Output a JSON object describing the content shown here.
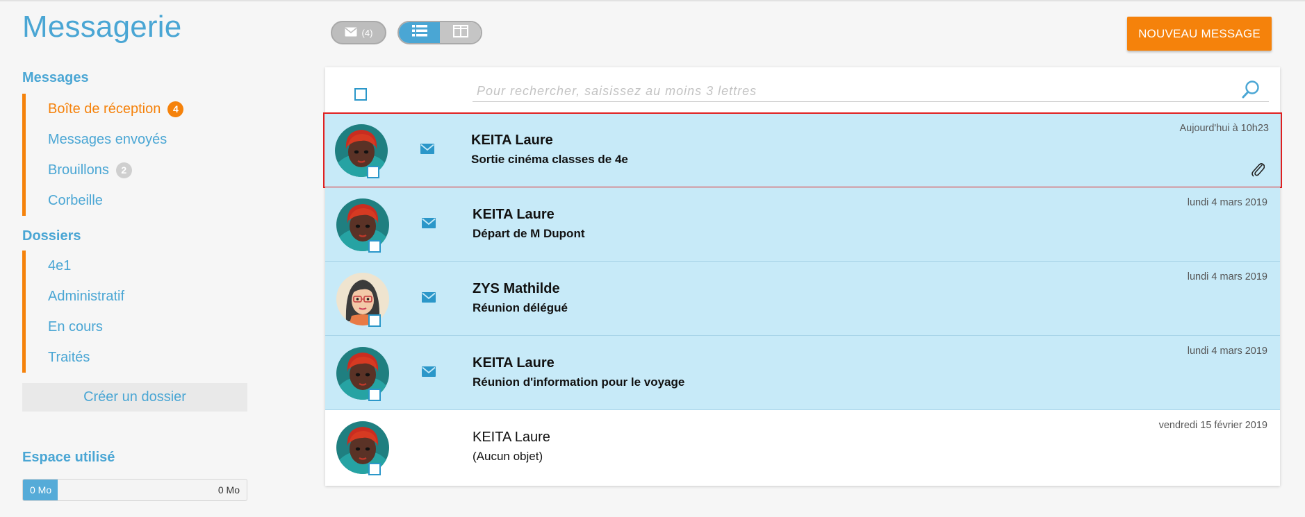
{
  "app": {
    "title": "Messagerie"
  },
  "sidebar": {
    "messages_title": "Messages",
    "message_items": [
      {
        "label": "Boîte de réception",
        "badge": "4",
        "badge_color": "#f5820b",
        "active": true
      },
      {
        "label": "Messages envoyés"
      },
      {
        "label": "Brouillons",
        "badge": "2",
        "badge_color": "#cfcfcf"
      },
      {
        "label": "Corbeille"
      }
    ],
    "folders_title": "Dossiers",
    "folder_items": [
      {
        "label": "4e1"
      },
      {
        "label": "Administratif"
      },
      {
        "label": "En cours"
      },
      {
        "label": "Traités"
      }
    ],
    "create_folder_label": "Créer un dossier",
    "storage_title": "Espace utilisé",
    "storage_used": "0 Mo",
    "storage_max": "0 Mo"
  },
  "toolbar": {
    "mail_count": "(4)",
    "new_message_label": "NOUVEAU MESSAGE",
    "view_modes": [
      {
        "icon": "list-icon",
        "active": true
      },
      {
        "icon": "split-view-icon",
        "active": false
      }
    ]
  },
  "search": {
    "placeholder": "Pour rechercher, saisissez au moins 3 lettres",
    "value": ""
  },
  "messages": [
    {
      "sender": "KEITA Laure",
      "subject": "Sortie cinéma classes de 4e",
      "date": "Aujourd'hui à 10h23",
      "unread": true,
      "attachment": true,
      "selected": true,
      "avatar": "redhead-avatar"
    },
    {
      "sender": "KEITA Laure",
      "subject": "Départ de M Dupont",
      "date": "lundi 4 mars 2019",
      "unread": true,
      "attachment": false,
      "avatar": "redhead-avatar"
    },
    {
      "sender": "ZYS Mathilde",
      "subject": "Réunion délégué",
      "date": "lundi 4 mars 2019",
      "unread": true,
      "attachment": false,
      "avatar": "glasses-avatar"
    },
    {
      "sender": "KEITA Laure",
      "subject": "Réunion d'information pour le voyage",
      "date": "lundi 4 mars 2019",
      "unread": true,
      "attachment": false,
      "avatar": "redhead-avatar"
    },
    {
      "sender": "KEITA Laure",
      "subject": "(Aucun objet)",
      "date": "vendredi 15 février 2019",
      "unread": false,
      "attachment": false,
      "avatar": "redhead-avatar"
    }
  ],
  "colors": {
    "accent": "#4aa6d4",
    "orange": "#f5820b",
    "unread_row": "#c7eaf8",
    "selected_outline": "#e02020"
  }
}
